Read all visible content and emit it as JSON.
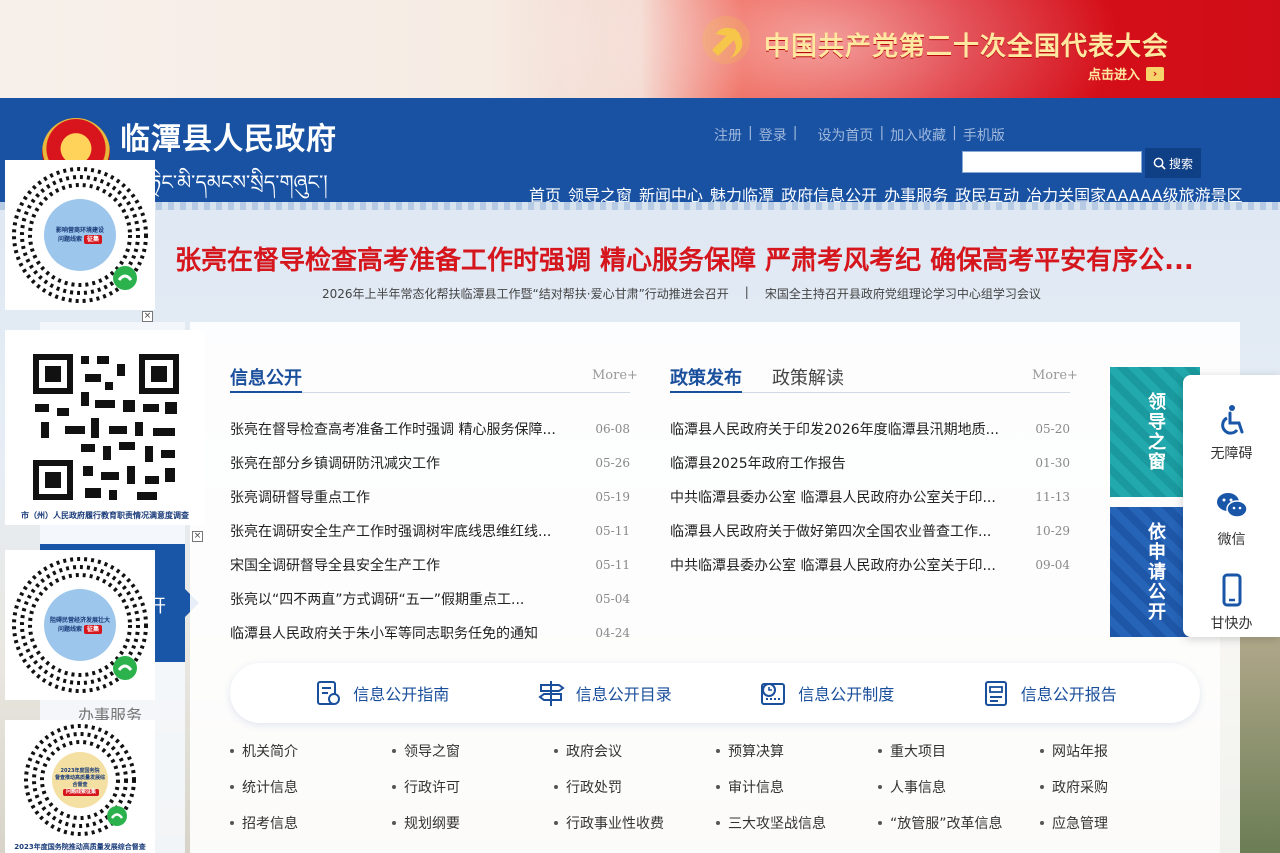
{
  "banner": {
    "title": "中国共产党第二十次全国代表大会",
    "enter": "点击进入",
    "colors": {
      "red": "#d9101a",
      "gold": "#ffe9a0"
    }
  },
  "header": {
    "site_title": "临潭县人民政府",
    "site_sub": "ཏྲེང་མི་དམངས་སྲིད་གཞུང་།",
    "toplinks": [
      "注册",
      "登录",
      "设为首页",
      "加入收藏",
      "手机版"
    ],
    "search_placeholder": "",
    "search_label": "搜索",
    "nav": [
      "首页",
      "领导之窗",
      "新闻中心",
      "魅力临潭",
      "政府信息公开",
      "办事服务",
      "政民互动",
      "冶力关国家AAAAA级旅游景区"
    ],
    "color": "#1952a3"
  },
  "headline": "张亮在督导检查高考准备工作时强调 精心服务保障 严肃考风考纪 确保高考平安有序公...",
  "subheads": [
    "2026年上半年常态化帮扶临潭县工作暨“结对帮扶·爱心甘肃”行动推进会召开",
    "|",
    "宋国全主持召开县政府党组理论学习中心组学习会议"
  ],
  "leftstrip": {
    "active_label": "开",
    "service_label": "办事服务"
  },
  "info": {
    "title": "信息公开",
    "more": "More+",
    "items": [
      {
        "title": "张亮在督导检查高考准备工作时强调 精心服务保障...",
        "date": "06-08"
      },
      {
        "title": "张亮在部分乡镇调研防汛减灾工作",
        "date": "05-26"
      },
      {
        "title": "张亮调研督导重点工作",
        "date": "05-19"
      },
      {
        "title": "张亮在调研安全生产工作时强调树牢底线思维红线...",
        "date": "05-11"
      },
      {
        "title": "宋国全调研督导全县安全生产工作",
        "date": "05-11"
      },
      {
        "title": "张亮以“四不两直”方式调研“五一”假期重点工...",
        "date": "05-04"
      },
      {
        "title": "临潭县人民政府关于朱小军等同志职务任免的通知",
        "date": "04-24"
      }
    ]
  },
  "policy": {
    "title": "政策发布",
    "title2": "政策解读",
    "more": "More+",
    "items": [
      {
        "title": "临潭县人民政府关于印发2026年度临潭县汛期地质...",
        "date": "05-20"
      },
      {
        "title": "临潭县2025年政府工作报告",
        "date": "01-30"
      },
      {
        "title": "中共临潭县委办公室 临潭县人民政府办公室关于印...",
        "date": "11-13"
      },
      {
        "title": "临潭县人民政府关于做好第四次全国农业普查工作...",
        "date": "10-29"
      },
      {
        "title": "中共临潭县委办公室 临潭县人民政府办公室关于印...",
        "date": "09-04"
      }
    ]
  },
  "guides": [
    {
      "label": "信息公开指南",
      "icon": "guide-icon"
    },
    {
      "label": "信息公开目录",
      "icon": "signpost-icon"
    },
    {
      "label": "信息公开制度",
      "icon": "clock-calendar-icon"
    },
    {
      "label": "信息公开报告",
      "icon": "report-icon"
    }
  ],
  "categories": [
    "机关简介",
    "领导之窗",
    "政府会议",
    "预算决算",
    "重大项目",
    "网站年报",
    "统计信息",
    "行政许可",
    "行政处罚",
    "审计信息",
    "人事信息",
    "政府采购",
    "招考信息",
    "规划纲要",
    "行政事业性收费",
    "三大攻坚战信息",
    "“放管服”改革信息",
    "应急管理"
  ],
  "tiles": [
    "领导之窗",
    "依申请公开"
  ],
  "toolbar": [
    "无障碍",
    "微信",
    "甘快办"
  ],
  "qr": {
    "badge1": "影响营商环境建设",
    "badge1b": "问题线索",
    "tag": "征集",
    "caption2": "市（州）人民政府履行教育职责情况满意度调查",
    "badge3": "阻碍民营经济发展壮大",
    "badge3b": "问题线索",
    "badge4": "2023年度国务院",
    "badge4b": "督查推动高质量发展综合督查",
    "badge4c": "问题线索征集",
    "caption4": "2023年度国务院推动高质量发展综合督查"
  }
}
